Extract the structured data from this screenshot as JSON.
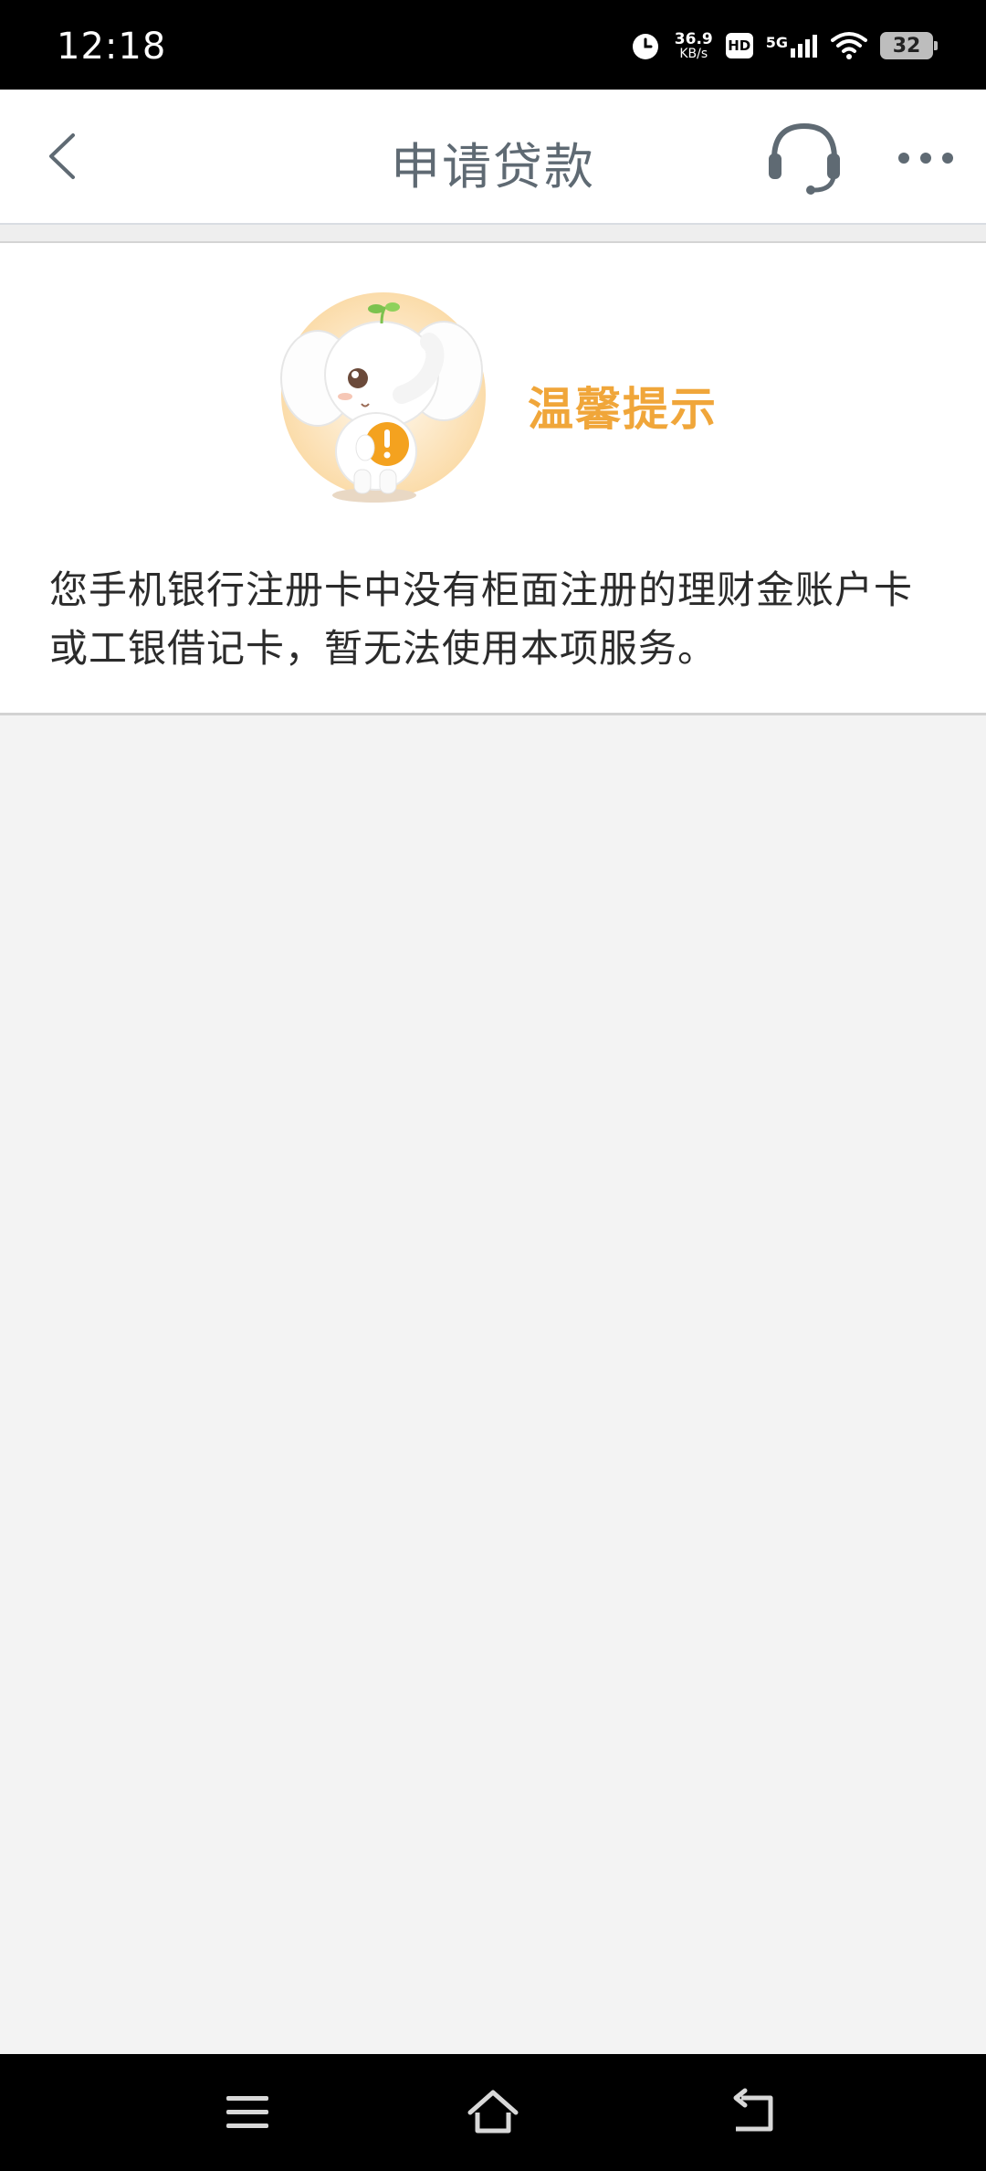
{
  "status_bar": {
    "time": "12:18",
    "net_speed_value": "36.9",
    "net_speed_unit": "KB/s",
    "hd_label": "HD",
    "network_label": "5G",
    "battery_level": "32",
    "icons": [
      "alarm-icon",
      "signal-icon",
      "wifi-icon",
      "battery-icon"
    ]
  },
  "header": {
    "title": "申请贷款",
    "icons": [
      "back-arrow-icon",
      "headset-icon",
      "more-dots-icon"
    ]
  },
  "notice": {
    "title": "温馨提示",
    "message": "您手机银行注册卡中没有柜面注册的理财金账户卡或工银借记卡，暂无法使用本项服务。",
    "colors": {
      "title": "#f0a63a",
      "mascot_bg": "#fde2b8",
      "badge": "#f4a21f"
    }
  },
  "navigation_bar": {
    "icons": [
      "menu-icon",
      "home-icon",
      "back-icon"
    ]
  }
}
